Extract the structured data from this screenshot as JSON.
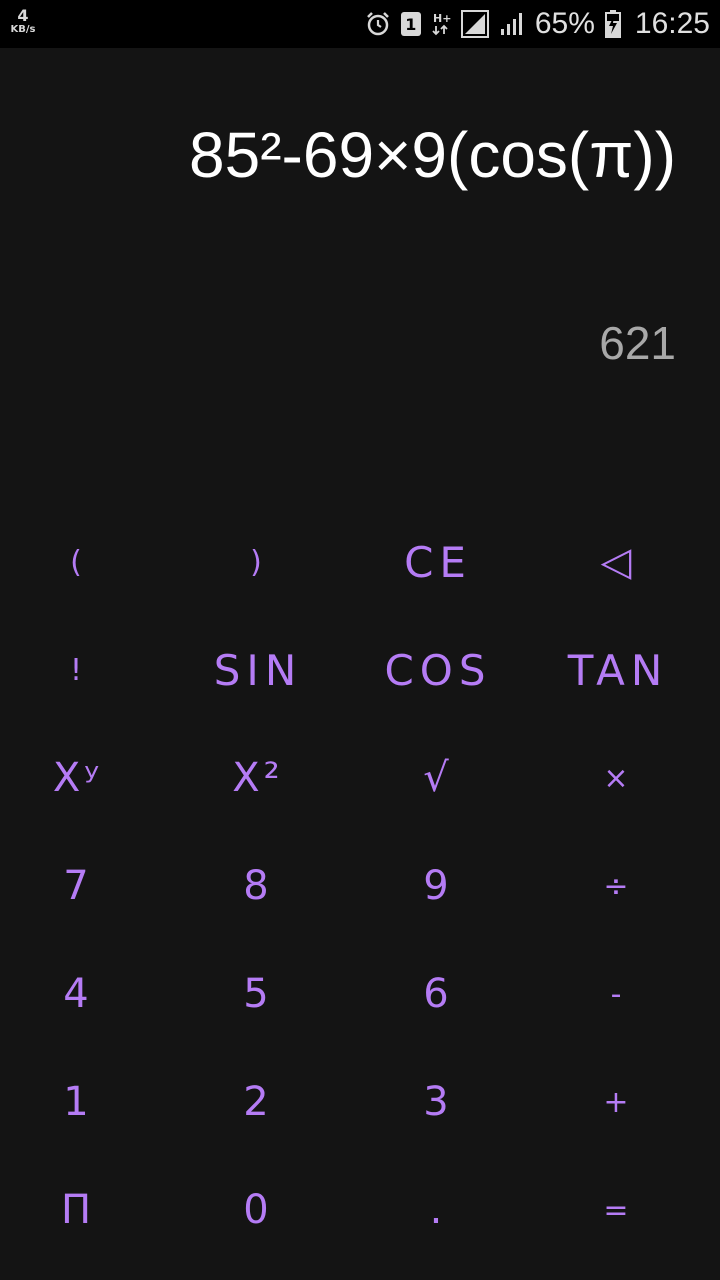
{
  "status_bar": {
    "net_speed_value": "4",
    "net_speed_unit": "KB/s",
    "sim_slot": "1",
    "network_type": "H+",
    "battery_percent": "65%",
    "time": "16:25",
    "icons": [
      "alarm-icon",
      "sim-1-icon",
      "hplus-data-icon",
      "signal-sim1-icon",
      "signal-sim2-icon",
      "battery-charging-icon"
    ]
  },
  "display": {
    "expression": "85²-69×9(cos(π))",
    "result": "621"
  },
  "keypad": {
    "rows": [
      [
        "(",
        ")",
        "CE",
        "◁"
      ],
      [
        "!",
        "SIN",
        "COS",
        "TAN"
      ],
      [
        "Xʸ",
        "X²",
        "√",
        "×"
      ],
      [
        "7",
        "8",
        "9",
        "÷"
      ],
      [
        "4",
        "5",
        "6",
        "-"
      ],
      [
        "1",
        "2",
        "3",
        "+"
      ],
      [
        "Π",
        "0",
        ".",
        "="
      ]
    ]
  },
  "colors": {
    "background": "#141414",
    "status_bar": "#000000",
    "accent": "#b57cf5",
    "expression_text": "#ffffff",
    "result_text": "#a8a8a8"
  }
}
